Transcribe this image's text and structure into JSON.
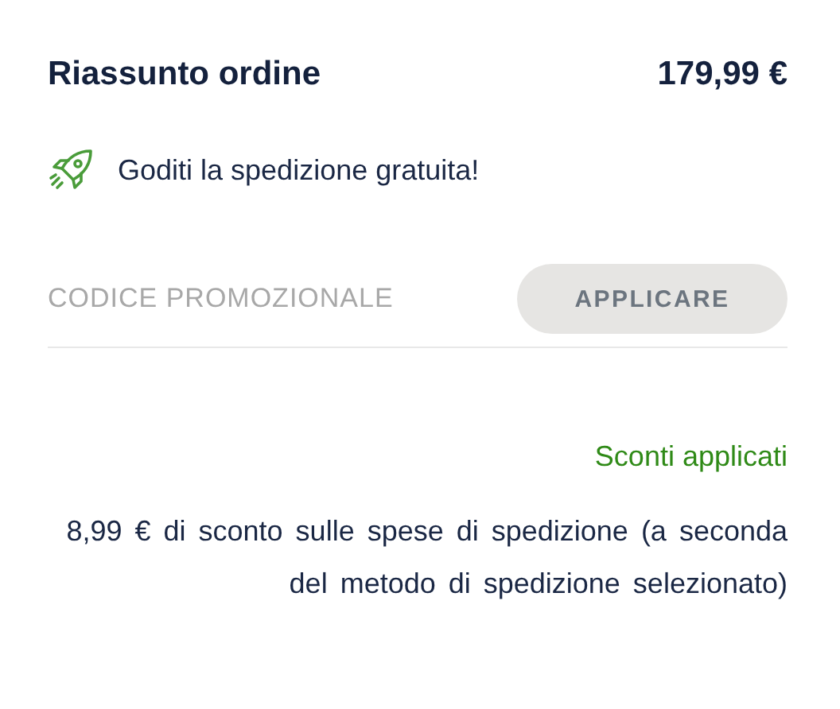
{
  "summary": {
    "title": "Riassunto ordine",
    "total": "179,99 €"
  },
  "shipping_notice": {
    "text": "Goditi la spedizione gratuita!"
  },
  "promo": {
    "placeholder": "CODICE PROMOZIONALE",
    "button": "APPLICARE"
  },
  "discounts": {
    "title": "Sconti applicati",
    "description": "8,99 € di sconto sulle spese di spedizione (a seconda del metodo di spedizione selezionato)"
  }
}
